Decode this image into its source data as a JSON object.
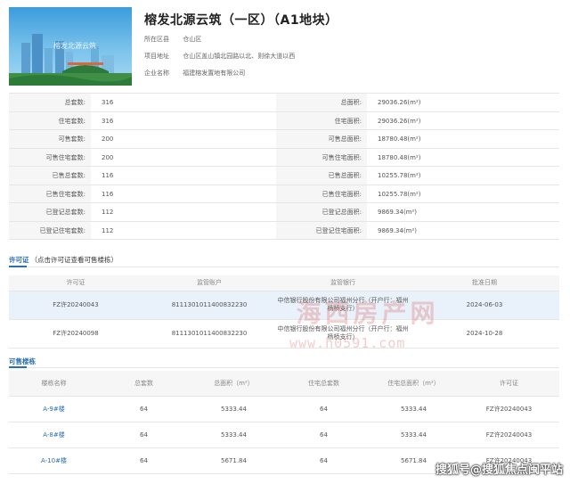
{
  "header": {
    "title": "榕发北源云筑（一区）（A1地块）",
    "hero_caption": "榕发北源云筑",
    "info": [
      {
        "label": "所在区县",
        "value": "仓山区"
      },
      {
        "label": "项目地址",
        "value": "仓山区盖山镇北园路以北、则徐大道以西"
      },
      {
        "label": "企业名称",
        "value": "福建榕发置地有限公司"
      }
    ]
  },
  "summary": [
    {
      "l1": "总套数:",
      "v1": "316",
      "l2": "总面积:",
      "v2": "29036.26(m²)"
    },
    {
      "l1": "住宅套数:",
      "v1": "316",
      "l2": "住宅面积:",
      "v2": "29036.26(m²)"
    },
    {
      "l1": "可售套数:",
      "v1": "200",
      "l2": "可售总面积:",
      "v2": "18780.48(m²)"
    },
    {
      "l1": "可售住宅套数:",
      "v1": "200",
      "l2": "可售住宅面积:",
      "v2": "18780.48(m²)"
    },
    {
      "l1": "已售总套数:",
      "v1": "116",
      "l2": "已售总面积:",
      "v2": "10255.78(m²)"
    },
    {
      "l1": "已售住宅套数:",
      "v1": "116",
      "l2": "已售住宅面积:",
      "v2": "10255.78(m²)"
    },
    {
      "l1": "已登记总套数:",
      "v1": "112",
      "l2": "已登记总面积:",
      "v2": "9869.34(m²)"
    },
    {
      "l1": "已登记住宅套数:",
      "v1": "112",
      "l2": "已登记住宅面积:",
      "v2": "9869.34(m²)"
    }
  ],
  "permits": {
    "title": "许可证",
    "subtitle": "（点击许可证查看可售楼栋）",
    "headers": [
      "许可证",
      "监管账户",
      "监管银行",
      "批准日期"
    ],
    "rows": [
      {
        "permit": "FZ许20240043",
        "account": "811130101140083​2230",
        "bank1": "中信银行股份有限公司福州分行（开户行：福州",
        "bank2": "杨桥支行）",
        "date": "2024-06-03"
      },
      {
        "permit": "FZ许20240098",
        "account": "811130101140083​2230",
        "bank1": "中信银行股份有限公司福州分行（开户行：福州",
        "bank2": "杨桥支行）",
        "date": "2024-10-28"
      }
    ]
  },
  "available": {
    "title": "可售楼栋",
    "headers": [
      "楼栋名称",
      "总套数",
      "总面积（m²）",
      "住宅总套数",
      "住宅总面积（m²）",
      "许可证"
    ],
    "rows": [
      {
        "name": "A-9#楼",
        "units": "64",
        "area": "5333.44",
        "res_units": "64",
        "res_area": "5333.44",
        "permit": "FZ许20240043"
      },
      {
        "name": "A-8#楼",
        "units": "64",
        "area": "5333.44",
        "res_units": "64",
        "res_area": "5333.44",
        "permit": "FZ许20240043"
      },
      {
        "name": "A-10#楼",
        "units": "64",
        "area": "5671.84",
        "res_units": "64",
        "res_area": "5671.84",
        "permit": "FZ许20240043"
      }
    ]
  },
  "watermark": {
    "text": "海西房产网",
    "url": "www.h0591.com"
  },
  "brand": "搜狐号@搜狐焦点闽平站",
  "colors": {
    "link": "#2a6fb0",
    "header_bg": "#f6f6f6",
    "highlight_row": "#e9f1fb",
    "watermark": "#d65650"
  }
}
